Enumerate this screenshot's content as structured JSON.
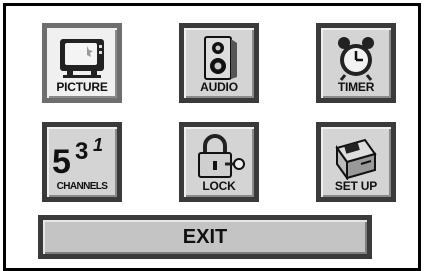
{
  "menu": {
    "items": [
      {
        "id": "picture",
        "label": "PICTURE",
        "icon": "tv-icon",
        "selected": true
      },
      {
        "id": "audio",
        "label": "AUDIO",
        "icon": "speaker-icon",
        "selected": false
      },
      {
        "id": "timer",
        "label": "TIMER",
        "icon": "alarm-clock-icon",
        "selected": false
      },
      {
        "id": "channels",
        "label": "CHANNELS",
        "icon": "channel-numbers-icon",
        "numbers": "531",
        "selected": false
      },
      {
        "id": "lock",
        "label": "LOCK",
        "icon": "padlock-key-icon",
        "selected": false
      },
      {
        "id": "setup",
        "label": "SET UP",
        "icon": "setup-toolbox-icon",
        "selected": false
      }
    ],
    "exit_label": "EXIT"
  },
  "colors": {
    "tile_border": "#3a3a3a",
    "tile_face": "#d4d4d4",
    "selected_face": "#f0f0f0",
    "exit_face": "#c4c4c4"
  }
}
